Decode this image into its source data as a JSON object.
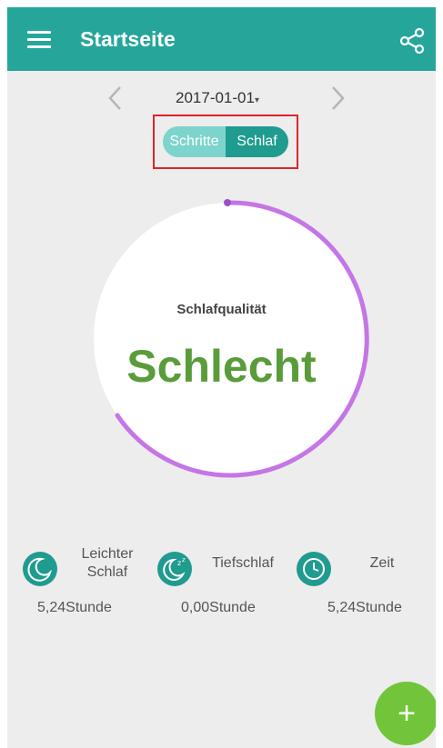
{
  "app_bar": {
    "title": "Startseite",
    "menu_icon": "hamburger-menu-icon",
    "share_icon": "share-icon",
    "background": "#26a69a"
  },
  "date_nav": {
    "date": "2017-01-01",
    "caret": "▾",
    "prev_icon": "chevron-left-icon",
    "next_icon": "chevron-right-icon"
  },
  "mode_toggle": {
    "options": [
      "Schritte",
      "Schlaf"
    ],
    "selected": "Schlaf"
  },
  "sleep_ring": {
    "label": "Schlafqualität",
    "value": "Schlecht",
    "value_color": "#5a9c3a",
    "arc_color": "#c476e6"
  },
  "stats": [
    {
      "label": "Leichter Schlaf",
      "label_lines": [
        "Leichter",
        "Schlaf"
      ],
      "value": "5,24Stunde",
      "icon": "moon-icon"
    },
    {
      "label": "Tiefschlaf",
      "value": "0,00Stunde",
      "icon": "moon-zzz-icon"
    },
    {
      "label": "Zeit",
      "value": "5,24Stunde",
      "icon": "clock-icon"
    }
  ],
  "fab": {
    "label": "+",
    "color": "#72c53b"
  }
}
